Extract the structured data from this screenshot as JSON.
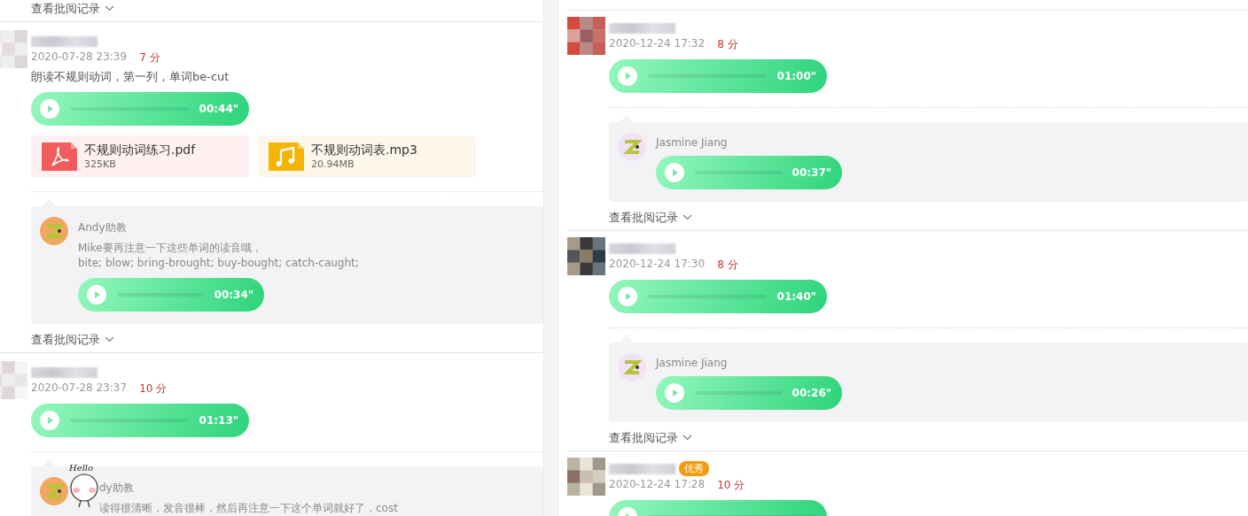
{
  "columns": [
    {
      "items": [
        {
          "kind": "review_link",
          "label": "查看批阅记录"
        },
        {
          "kind": "submission",
          "date": "2020-07-28 23:39",
          "score": "7 分",
          "text": "朗读不规则动词，第一列，单词be-cut",
          "audio": {
            "duration": "00:44\""
          },
          "attachments": [
            {
              "kind": "pdf",
              "name": "不规则动词练习.pdf",
              "size": "325KB"
            },
            {
              "kind": "music",
              "name": "不规则动词表.mp3",
              "size": "20.94MB"
            }
          ],
          "comment": {
            "author": "Andy助教",
            "color": "#f0a860",
            "text_lines": [
              "Mike要再注意一下这些单词的读音哦，",
              "bite; blow; bring-brought; buy-bought; catch-caught;"
            ],
            "audio": {
              "duration": "00:34\""
            }
          }
        },
        {
          "kind": "review_link",
          "label": "查看批阅记录"
        },
        {
          "kind": "submission",
          "date": "2020-07-28 23:37",
          "score": "10 分",
          "audio": {
            "duration": "01:13\""
          },
          "comment": {
            "author": "dy助教",
            "color": "#f0a860",
            "sticker": {
              "text": "Hello"
            },
            "text_lines": [
              "读得很清晰，发音很棒，然后再注意一下这个单词就好了，cost"
            ]
          }
        }
      ]
    },
    {
      "items": [
        {
          "kind": "submission",
          "date": "2020-12-24 17:32",
          "score": "8 分",
          "audio": {
            "duration": "01:00\""
          },
          "comment": {
            "author": "Jasmine Jiang",
            "color": "#efe3f5",
            "audio": {
              "duration": "00:37\""
            }
          }
        },
        {
          "kind": "review_link",
          "label": "查看批阅记录"
        },
        {
          "kind": "submission",
          "date": "2020-12-24 17:30",
          "score": "8 分",
          "audio": {
            "duration": "01:40\""
          },
          "comment": {
            "author": "Jasmine Jiang",
            "color": "#efe3f5",
            "audio": {
              "duration": "00:26\""
            }
          }
        },
        {
          "kind": "review_link",
          "label": "查看批阅记录"
        },
        {
          "kind": "submission",
          "date": "2020-12-24 17:28",
          "score": "10 分",
          "badge": "优秀",
          "has_audio": true
        }
      ]
    }
  ]
}
